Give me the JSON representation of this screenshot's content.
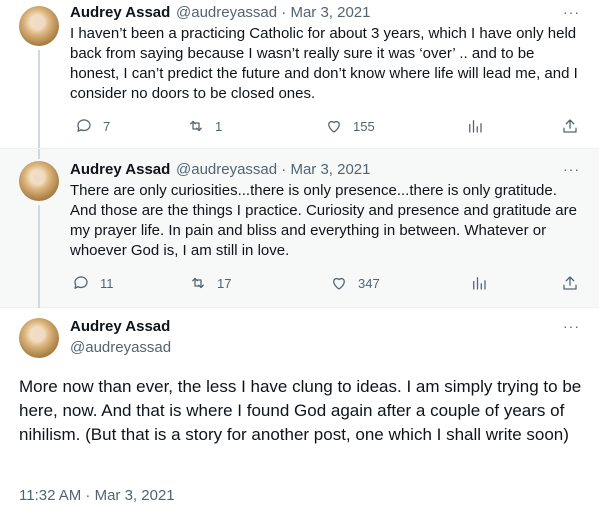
{
  "tweets": [
    {
      "name": "Audrey Assad",
      "handle_meta": "@audreyassad · Mar 3, 2021",
      "text": "I haven’t been a practicing Catholic for about 3 years, which I have only held back from saying because I wasn’t really sure it was ‘over’ .. and to be honest, I can’t predict the future and don’t know where life will lead me, and I consider no doors to be closed ones.",
      "replies": "7",
      "retweets": "1",
      "likes": "155"
    },
    {
      "name": "Audrey Assad",
      "handle_meta": "@audreyassad · Mar 3, 2021",
      "text": "There are only curiosities...there is only presence...there is only gratitude. And those are the things I practice. Curiosity and presence and gratitude are my prayer life. In pain and bliss and everything in between. Whatever or whoever God is, I am still in love.",
      "replies": "11",
      "retweets": "17",
      "likes": "347"
    }
  ],
  "main_tweet": {
    "name": "Audrey Assad",
    "handle": "@audreyassad",
    "text": "More now than ever, the less I have clung to ideas. I am simply trying to be here, now. And that is where I found God again after a couple of years of nihilism. (But that is a story for another post, one which I shall write soon)",
    "timestamp": "11:32 AM · Mar 3, 2021"
  },
  "icons": {
    "reply": "reply-icon",
    "retweet": "retweet-icon",
    "like": "like-icon",
    "views": "analytics-icon",
    "share": "share-icon",
    "more": "more-icon"
  },
  "more_label": "···",
  "colors": {
    "text": "#0f1419",
    "secondary": "#536471",
    "thread_line": "#cfd9de",
    "highlight_bg": "#f7f9f9"
  }
}
